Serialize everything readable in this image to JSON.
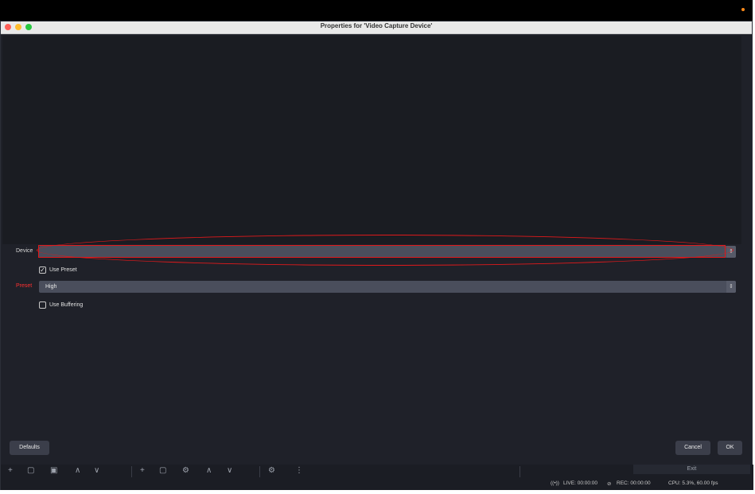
{
  "window": {
    "title": "Properties for 'Video Capture Device'"
  },
  "form": {
    "device_label": "Device",
    "device_value": "",
    "use_preset_label": "Use Preset",
    "use_preset_checked": true,
    "preset_label": "Preset",
    "preset_value": "High",
    "use_buffering_label": "Use Buffering",
    "use_buffering_checked": false
  },
  "buttons": {
    "defaults": "Defaults",
    "cancel": "Cancel",
    "ok": "OK"
  },
  "dock": {
    "exit_label": "Exit"
  },
  "status": {
    "live": "LIVE: 00:00:00",
    "rec": "REC: 00:00:00",
    "cpu": "CPU: 5.3%, 60.00 fps"
  },
  "colors": {
    "annotation": "#e0191b",
    "preset_label": "#ff3030",
    "background": "#1f2129"
  },
  "icons": {
    "stepper": "up-down-arrows-icon",
    "checkmark": "checkmark-icon",
    "live": "broadcast-icon",
    "rec": "record-off-icon"
  }
}
